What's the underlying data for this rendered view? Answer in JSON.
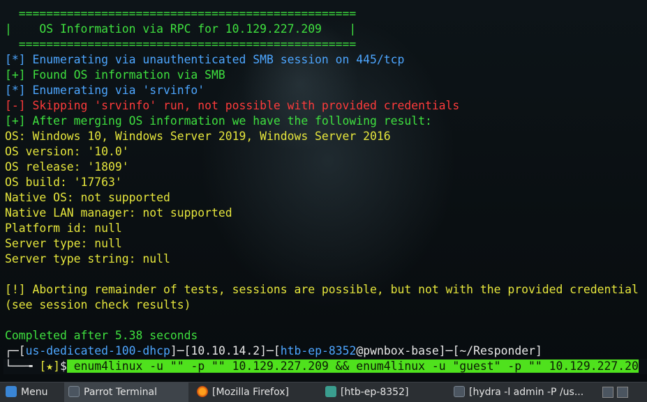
{
  "terminal": {
    "lines": [
      "  =================================================",
      "|    OS Information via RPC for 10.129.227.209    |",
      "  =================================================",
      "[*] Enumerating via unauthenticated SMB session on 445/tcp",
      "[+] Found OS information via SMB",
      "[*] Enumerating via 'srvinfo'",
      "[-] Skipping 'srvinfo' run, not possible with provided credentials",
      "[+] After merging OS information we have the following result:",
      "OS: Windows 10, Windows Server 2019, Windows Server 2016",
      "OS version: '10.0'",
      "OS release: '1809'",
      "OS build: '17763'",
      "Native OS: not supported",
      "Native LAN manager: not supported",
      "Platform id: null",
      "Server type: null",
      "Server type string: null",
      "[!] Aborting remainder of tests, sessions are possible, but not with the provided credential",
      "(see session check results)",
      "Completed after 5.38 seconds"
    ],
    "prompt": {
      "corner_top": "┌─",
      "user_host": "us-dedicated-100-dhcp",
      "ip": "10.10.14.2",
      "user": "htb-ep-8352",
      "at_host": "@pwnbox-base",
      "cwd": "~/Responder",
      "sep_left": "[",
      "sep_right": "]",
      "dash": "─",
      "corner_bottom": "└──╼ ",
      "star": "[★]",
      "dollar": "$",
      "command": " enum4linux -u \"\" -p \"\" 10.129.227.209 && enum4linux -u \"guest\" -p \"\" 10.129.227.",
      "cursor_text": "20"
    }
  },
  "taskbar": {
    "menu_label": "Menu",
    "items": [
      "Parrot Terminal",
      "[Mozilla Firefox]",
      "[htb-ep-8352]",
      "[hydra -l admin -P /us..."
    ]
  },
  "colors": {
    "green": "#3fe03f",
    "blue": "#4da6ff",
    "red": "#ff3b3b",
    "yellow": "#e6e63c",
    "highlight": "#4fe11d"
  }
}
